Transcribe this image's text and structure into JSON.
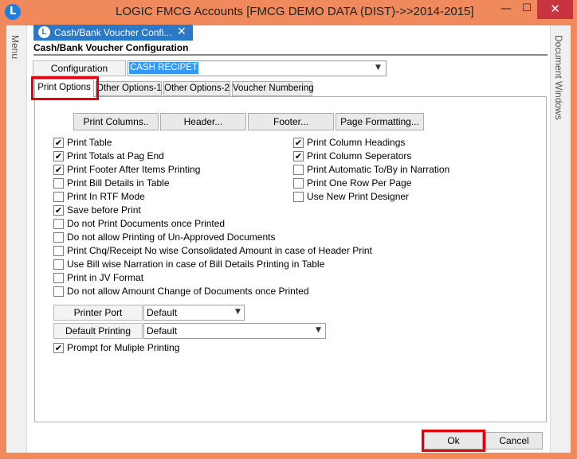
{
  "window": {
    "title": "LOGIC FMCG Accounts  [FMCG DEMO DATA (DIST)->>2014-2015]",
    "app_icon": "L",
    "min_glyph": "—",
    "max_glyph": "☐",
    "close_glyph": "✕"
  },
  "side": {
    "menu_label": "Menu",
    "docwin_label": "Document Windows"
  },
  "doc_tab": {
    "label": "Cash/Bank Voucher Confi...",
    "close": "✕"
  },
  "form": {
    "title": "Cash/Bank Voucher Configuration",
    "config_label": "Configuration",
    "config_value": "CASH RECIPET"
  },
  "tabs": [
    "Print Options",
    "Other Options-1",
    "Other Options-2",
    "Voucher Numbering"
  ],
  "buttons": {
    "print_columns": "Print Columns..",
    "header": "Header...",
    "footer": "Footer...",
    "page_formatting": "Page Formatting...",
    "ok": "Ok",
    "cancel": "Cancel"
  },
  "left_options": [
    {
      "label": "Print Table",
      "checked": true
    },
    {
      "label": "Print Totals at Pag End",
      "checked": true
    },
    {
      "label": "Print Footer After Items Printing",
      "checked": true
    },
    {
      "label": "Print Bill Details in Table",
      "checked": false
    },
    {
      "label": "Print In RTF Mode",
      "checked": false
    },
    {
      "label": "Save before Print",
      "checked": true
    },
    {
      "label": "Do not Print Documents once Printed",
      "checked": false
    },
    {
      "label": "Do not allow Printing of Un-Approved Documents",
      "checked": false
    },
    {
      "label": "Print Chq/Receipt No wise Consolidated Amount in case of Header Print",
      "checked": false
    },
    {
      "label": "Use Bill wise Narration in case of Bill Details Printing in Table",
      "checked": false
    },
    {
      "label": "Print in JV Format",
      "checked": false
    },
    {
      "label": "Do not allow Amount Change of Documents once Printed",
      "checked": false
    }
  ],
  "right_options": [
    {
      "label": "Print Column Headings",
      "checked": true
    },
    {
      "label": "Print Column Seperators",
      "checked": true
    },
    {
      "label": "Print Automatic To/By in Narration",
      "checked": false
    },
    {
      "label": "Print One Row Per Page",
      "checked": false
    },
    {
      "label": "Use New Print Designer",
      "checked": false
    }
  ],
  "printer": {
    "port_label": "Printer Port",
    "port_value": "Default",
    "default_label": "Default Printing",
    "default_value": "Default"
  },
  "prompt_option": {
    "label": "Prompt for Muliple Printing",
    "checked": true
  },
  "glyphs": {
    "check": "✔",
    "dropdown": "▼"
  }
}
